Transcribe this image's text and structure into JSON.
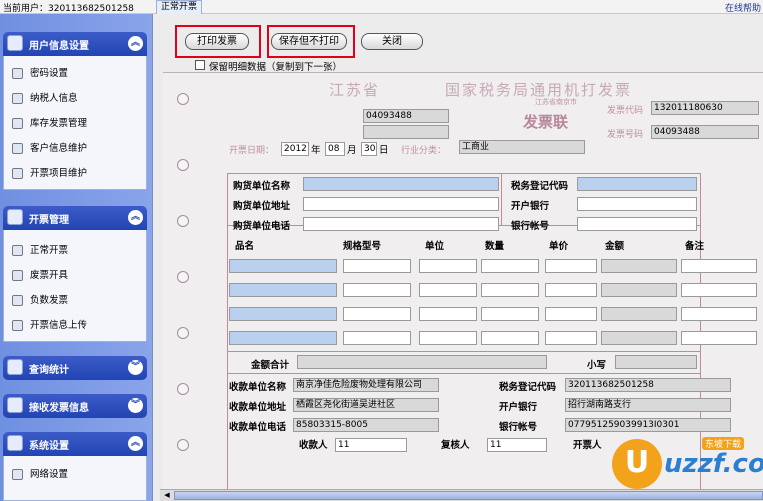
{
  "topbar": {
    "user": "当前用户：320113682501258",
    "tab": "正常开票",
    "help": "在线帮助"
  },
  "sidebar": {
    "sections": [
      {
        "title": "用户信息设置",
        "items": [
          "密码设置",
          "纳税人信息",
          "库存发票管理",
          "客户信息维护",
          "开票项目维护"
        ]
      },
      {
        "title": "开票管理",
        "items": [
          "正常开票",
          "废票开具",
          "负数发票",
          "开票信息上传"
        ]
      },
      {
        "title": "查询统计",
        "items": []
      },
      {
        "title": "接收发票信息",
        "items": []
      },
      {
        "title": "系统设置",
        "items": [
          "网络设置"
        ]
      }
    ],
    "toggle_up": "︽",
    "toggle_down": "︾"
  },
  "toolbar": {
    "print_label": "打印发票",
    "save_label": "保存但不打印",
    "close_label": "关闭",
    "keep_label": "保留明细数据（复制到下一张）",
    "accent": "#e0001b"
  },
  "invoice": {
    "province": "江苏省",
    "title": "国家税务局通用机打发票",
    "seal_text": "江苏省南京市",
    "seal_sub": "发票联",
    "code_box": "04093488",
    "invoice_code_label": "发票代码",
    "invoice_code": "132011180630",
    "invoice_number_label": "发票号码",
    "invoice_number": "04093488",
    "date_label": "开票日期：",
    "year": "2012",
    "year_unit": "年",
    "month": "08",
    "month_unit": "月",
    "day": "30",
    "day_unit": "日",
    "industry_label": "行业分类：",
    "industry": "工商业",
    "buyer": {
      "name_label": "购货单位名称",
      "address_label": "购货单位地址",
      "phone_label": "购货单位电话",
      "tax_label": "税务登记代码",
      "bank_label": "开户银行",
      "account_label": "银行帐号"
    },
    "columns": [
      "品名",
      "规格型号",
      "单位",
      "数量",
      "单价",
      "金额",
      "备注"
    ],
    "total_label": "金额合计",
    "total_upper_label": "小写",
    "payee": {
      "name_label": "收款单位名称",
      "name": "南京净佳危险废物处理有限公司",
      "address_label": "收款单位地址",
      "address": "栖霞区尧化街道吴进社区",
      "phone_label": "收款单位电话",
      "phone": "85803315-8005",
      "tax_label": "税务登记代码",
      "tax": "320113682501258",
      "bank_label": "开户银行",
      "bank": "招行湖南路支行",
      "account_label": "银行帐号",
      "account": "077951259039913I0301"
    },
    "cashier_label": "收款人",
    "cashier": "11",
    "reviewer_label": "复核人",
    "reviewer": "11",
    "issuer_label": "开票人"
  },
  "watermark": {
    "letter": "U",
    "brand": "uzzf.com",
    "badge": "东坡下载"
  }
}
